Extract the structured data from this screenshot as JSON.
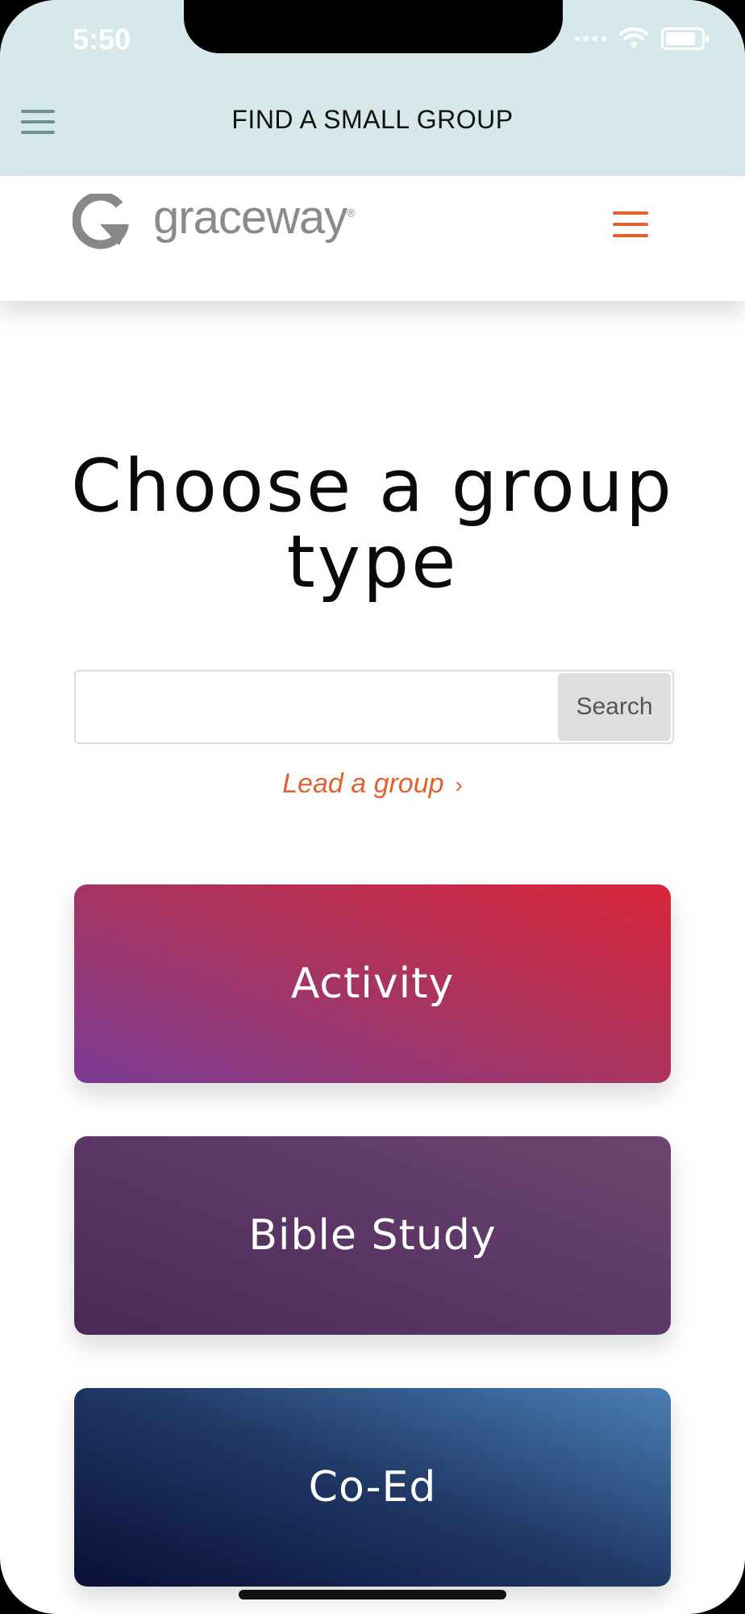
{
  "status": {
    "time": "5:50"
  },
  "navbar": {
    "title": "FIND A SMALL GROUP"
  },
  "site": {
    "logo_text": "graceway",
    "logo_reg": "®",
    "accent": "#e2622f"
  },
  "main": {
    "heading_line1": "Choose a group",
    "heading_line2": "type",
    "search": {
      "placeholder": "",
      "value": "",
      "button_label": "Search"
    },
    "lead_link": "Lead a group",
    "lead_chevron": "›",
    "group_types": [
      {
        "label": "Activity"
      },
      {
        "label": "Bible Study"
      },
      {
        "label": "Co-Ed"
      }
    ]
  }
}
